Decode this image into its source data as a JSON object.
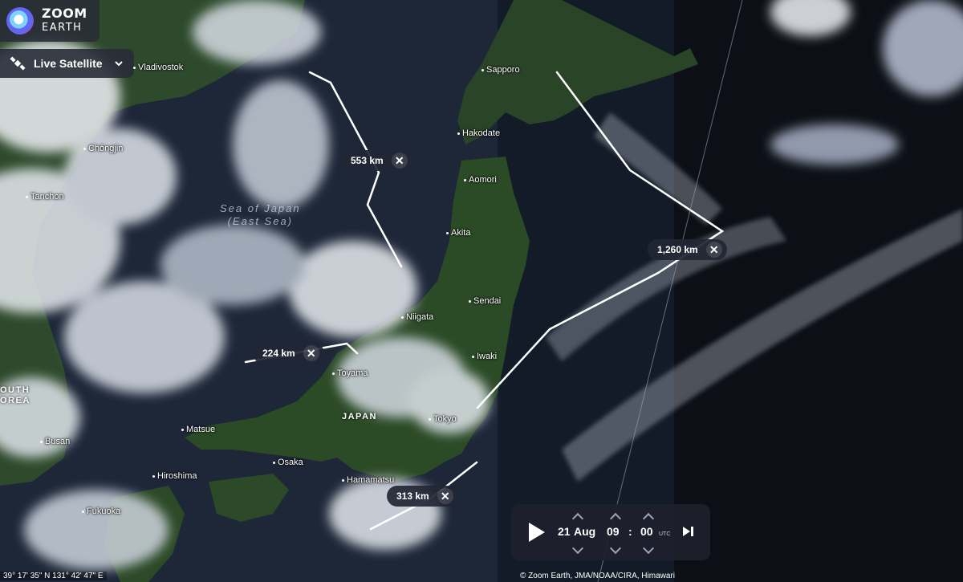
{
  "brand": {
    "line1": "ZOOM",
    "line2": "EARTH"
  },
  "layer_selector": {
    "label": "Live Satellite",
    "icon": "satellite-icon"
  },
  "cities": [
    {
      "key": "vladivostok",
      "label": "Vladivostok"
    },
    {
      "key": "chongjin",
      "label": "Chŏngjin"
    },
    {
      "key": "tanchon",
      "label": "Tanchon"
    },
    {
      "key": "sapporo",
      "label": "Sapporo"
    },
    {
      "key": "hakodate",
      "label": "Hakodate"
    },
    {
      "key": "aomori",
      "label": "Aomori"
    },
    {
      "key": "akita",
      "label": "Akita"
    },
    {
      "key": "sendai",
      "label": "Sendai"
    },
    {
      "key": "niigata",
      "label": "Niigata"
    },
    {
      "key": "iwaki",
      "label": "Iwaki"
    },
    {
      "key": "toyama",
      "label": "Toyama"
    },
    {
      "key": "tokyo",
      "label": "Tokyo"
    },
    {
      "key": "matsue",
      "label": "Matsue"
    },
    {
      "key": "busan",
      "label": "Busan"
    },
    {
      "key": "osaka",
      "label": "Osaka"
    },
    {
      "key": "hiroshima",
      "label": "Hiroshima"
    },
    {
      "key": "hamamatsu",
      "label": "Hamamatsu"
    },
    {
      "key": "fukuoka",
      "label": "Fukuoka"
    }
  ],
  "sea_label": {
    "line1": "Sea of Japan",
    "line2": "(East Sea)"
  },
  "countries": {
    "japan": "JAPAN",
    "south_korea_line1": "OUTH",
    "south_korea_line2": "OREA"
  },
  "measurements": [
    {
      "key": "m553",
      "label": "553 km"
    },
    {
      "key": "m1260",
      "label": "1,260 km"
    },
    {
      "key": "m224",
      "label": "224 km"
    },
    {
      "key": "m313",
      "label": "313 km"
    }
  ],
  "time": {
    "day": "21",
    "month": "Aug",
    "hour": "09",
    "minute": "00",
    "zone": "UTC"
  },
  "status": {
    "coordinates": "39° 17' 35\" N   131° 42' 47\" E",
    "attribution": "© Zoom Earth, JMA/NOAA/CIRA, Himawari"
  },
  "colors": {
    "ocean": "#131b29",
    "land": "#2b4a25",
    "cloud": "#e9edf2",
    "panel": "#282c38"
  }
}
